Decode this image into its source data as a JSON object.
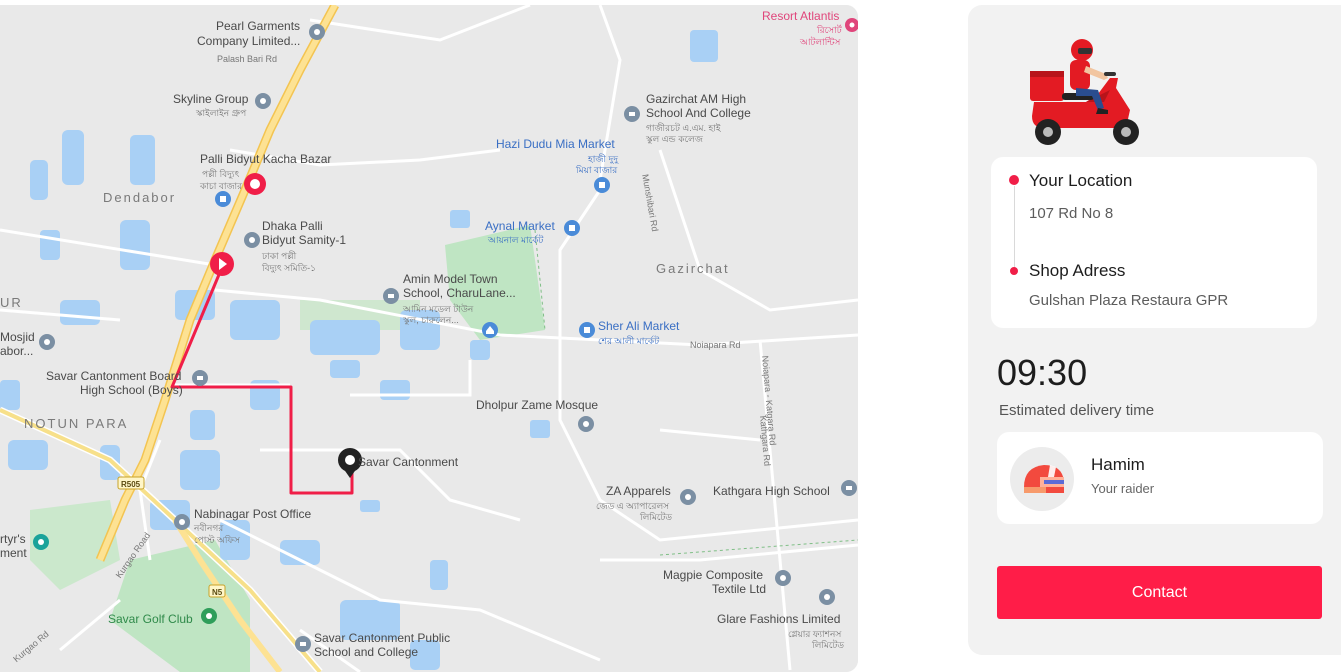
{
  "map": {
    "places": [
      {
        "name": "Pearl Garments Company Limited...",
        "line1": "Pearl Garments",
        "line2": "Company Limited..."
      },
      {
        "road": "Palash Bari Rd"
      },
      {
        "name": "Skyline Group",
        "bn": "স্কাইলাইন গ্রুপ"
      },
      {
        "name": "Palli Bidyut Kacha Bazar",
        "bn1": "পল্লী বিদ্যুৎ",
        "bn2": "কাচা বাজার"
      },
      {
        "area": "Dendabor"
      },
      {
        "name": "Dhaka Palli Bidyut Samity-1",
        "line1": "Dhaka Palli",
        "line2": "Bidyut Samity-1",
        "bn1": "ঢাকা পল্লী",
        "bn2": "বিদ্যুৎ সমিতি-১"
      },
      {
        "area": "UR"
      },
      {
        "name": "Mosjid Dabor...",
        "line1": "Mosjid",
        "line2": "abor..."
      },
      {
        "name": "Savar Cantonment Board High School (Boys)",
        "line1": "Savar Cantonment Board",
        "line2": "High School (Boys)"
      },
      {
        "area": "NOTUN PARA"
      },
      {
        "name": "Savar Cantonment"
      },
      {
        "name": "Nabinagar Post Office",
        "bn1": "নবীনগর",
        "bn2": "পোস্ট অফিস"
      },
      {
        "name": "Martyr's Monument",
        "line1": "rtyr's",
        "line2": "ment"
      },
      {
        "name": "Savar Golf Club"
      },
      {
        "name": "Savar Cantonment Public School and College",
        "line1": "Savar Cantonment Public",
        "line2": "School and College"
      },
      {
        "name": "Resort Atlantis",
        "bn1": "রিসোর্ট",
        "bn2": "আটলান্টিস"
      },
      {
        "name": "Gazirchat AM High School And College",
        "line1": "Gazirchat AM High",
        "line2": "School And College",
        "bn1": "গাজীরচট এ.এম. হাই",
        "bn2": "স্কুল এন্ড কলেজ"
      },
      {
        "name": "Hazi Dudu Mia Market",
        "bn1": "হাজী দুদু",
        "bn2": "মিয়া বাজার"
      },
      {
        "name": "Aynal Market",
        "bn": "আয়নাল মার্কেট"
      },
      {
        "area": "Gazirchat"
      },
      {
        "name": "Amin Model Town School, CharuLane...",
        "line1": "Amin Model Town",
        "line2": "School, CharuLane...",
        "bn1": "আমিন মডেল টাউন",
        "bn2": "স্কুল, চারুলেন..."
      },
      {
        "name": "Sher Ali Market",
        "bn": "শের আলী মার্কেট"
      },
      {
        "road": "Noiapara Rd"
      },
      {
        "name": "Dholpur Zame Mosque"
      },
      {
        "name": "ZA Apparels",
        "bn1": "জেড এ অ্যাপারেলস",
        "bn2": "লিমিটেড"
      },
      {
        "name": "Kathgara High School"
      },
      {
        "name": "Magpie Composite Textile Ltd",
        "line1": "Magpie Composite",
        "line2": "Textile Ltd"
      },
      {
        "name": "Glare Fashions Limited",
        "bn1": "গ্লেয়ার ফ্যাশনস",
        "bn2": "লিমিটেড"
      },
      {
        "road": "Munshibari Rd"
      },
      {
        "road": "Noiapara - Katgara Rd"
      },
      {
        "road": "R505"
      },
      {
        "road": "N5"
      },
      {
        "road": "Kurgao Road"
      },
      {
        "road": "Kurgao Rd"
      },
      {
        "road": "Kathgara Rd"
      }
    ],
    "road_badges": [
      "R505",
      "N5"
    ]
  },
  "panel": {
    "your_location_title": "Your Location",
    "your_location_value": "107 Rd No 8",
    "shop_address_title": "Shop Adress",
    "shop_address_value": "Gulshan Plaza Restaura GPR",
    "time": "09:30",
    "time_label": "Estimated delivery time",
    "raider_name": "Hamim",
    "raider_role": "Your raider",
    "contact_label": "Contact",
    "accent_color": "#ff1d48"
  }
}
